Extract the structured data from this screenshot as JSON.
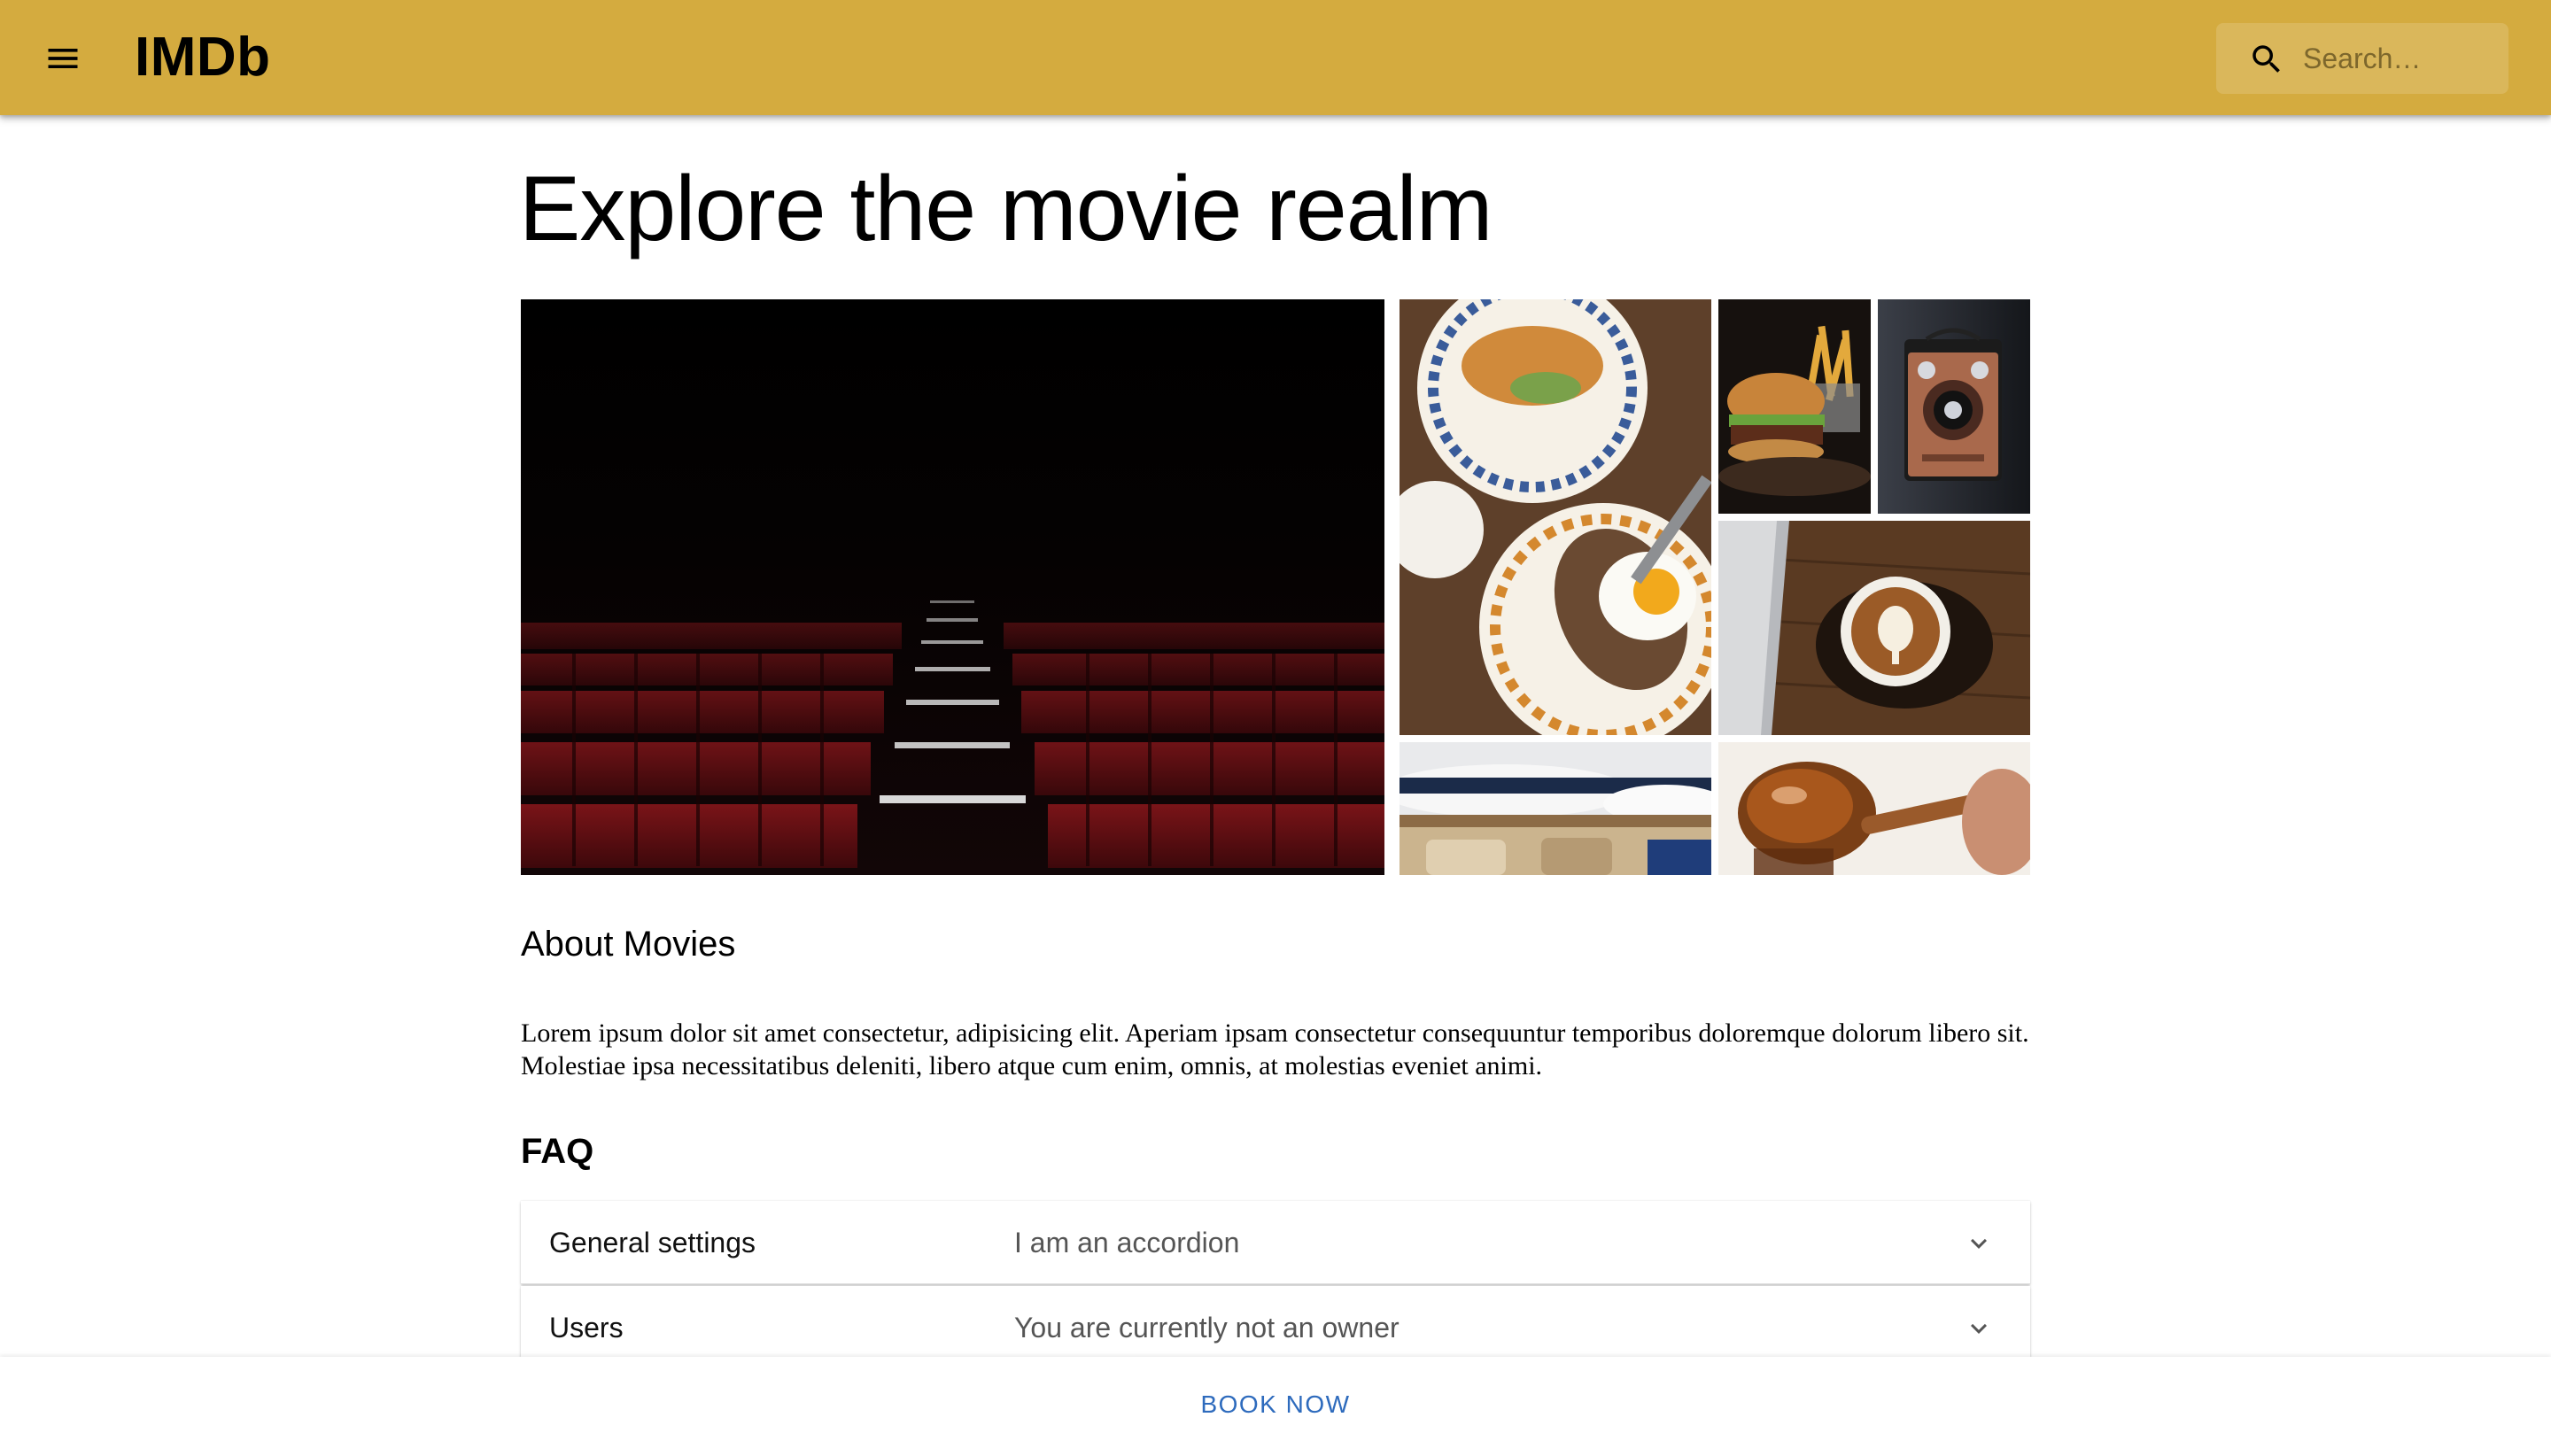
{
  "header": {
    "brand": "IMDb",
    "search_placeholder": "Search…",
    "bar_color": "#d4ab3f"
  },
  "main": {
    "title": "Explore the movie realm",
    "gallery": {
      "items": [
        {
          "name": "theater-seats-image"
        },
        {
          "name": "breakfast-plates-image"
        },
        {
          "name": "burger-fries-image"
        },
        {
          "name": "vintage-camera-image"
        },
        {
          "name": "latte-coffee-image"
        },
        {
          "name": "hats-image"
        },
        {
          "name": "honey-dipper-image"
        }
      ]
    },
    "about": {
      "heading": "About Movies",
      "text": "Lorem ipsum dolor sit amet consectetur, adipisicing elit. Aperiam ipsam consectetur consequuntur temporibus doloremque dolorum libero sit. Molestiae ipsa necessitatibus deleniti, libero atque cum enim, omnis, at molestias eveniet animi."
    },
    "faq": {
      "heading": "FAQ",
      "items": [
        {
          "title": "General settings",
          "summary": "I am an accordion"
        },
        {
          "title": "Users",
          "summary": "You are currently not an owner"
        }
      ]
    }
  },
  "footer": {
    "cta_label": "BOOK NOW",
    "cta_color": "#2e6bbd"
  },
  "icons": {
    "menu": "menu-icon",
    "search": "search-icon",
    "expand": "chevron-down-icon"
  }
}
